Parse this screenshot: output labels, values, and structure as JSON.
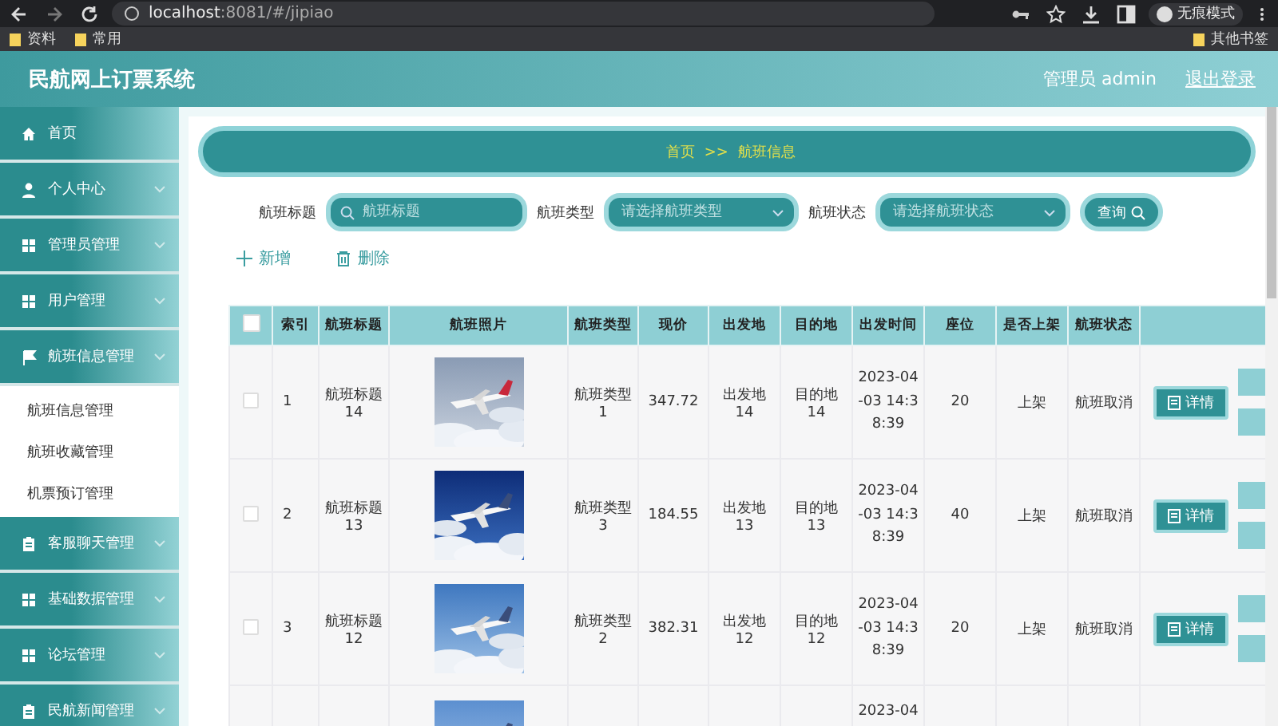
{
  "browser": {
    "url_host": "localhost",
    "url_rest": ":8081/#/jipiao",
    "profile": "无痕模式",
    "bookmarks": [
      "资料",
      "常用"
    ],
    "other_bookmarks": "其他书签"
  },
  "header": {
    "title": "民航网上订票系统",
    "user": "管理员 admin",
    "logout": "退出登录"
  },
  "sidebar": {
    "items": [
      {
        "label": "首页",
        "kind": "home"
      },
      {
        "label": "个人中心",
        "kind": "user"
      },
      {
        "label": "管理员管理",
        "kind": "grid"
      },
      {
        "label": "用户管理",
        "kind": "grid"
      },
      {
        "label": "航班信息管理",
        "kind": "flag",
        "children": [
          {
            "label": "航班信息管理"
          },
          {
            "label": "航班收藏管理"
          },
          {
            "label": "机票预订管理"
          }
        ]
      },
      {
        "label": "客服聊天管理",
        "kind": "clipboard"
      },
      {
        "label": "基础数据管理",
        "kind": "grid"
      },
      {
        "label": "论坛管理",
        "kind": "grid"
      },
      {
        "label": "民航新闻管理",
        "kind": "clipboard"
      }
    ]
  },
  "breadcrumb": "首页 >> 航班信息",
  "search": {
    "fields": [
      {
        "label": "航班标题",
        "kind": "input",
        "placeholder": "航班标题"
      },
      {
        "label": "航班类型",
        "kind": "select",
        "placeholder": "请选择航班类型"
      },
      {
        "label": "航班状态",
        "kind": "select",
        "placeholder": "请选择航班状态"
      }
    ],
    "button": "查询"
  },
  "actions": [
    {
      "kind": "add",
      "label": "新增"
    },
    {
      "kind": "delete",
      "label": "删除"
    }
  ],
  "table": {
    "all_selected": false,
    "columns": [
      "索引",
      "航班标题",
      "航班照片",
      "航班类型",
      "现价",
      "出发地",
      "目的地",
      "出发时间",
      "座位",
      "是否上架",
      "航班状态"
    ],
    "rows": [
      {
        "selected": false,
        "cells": [
          "1",
          "航班标题14",
          {
            "kind": "picture"
          },
          "航班类型1",
          "347.72",
          "出发地14",
          "目的地14",
          "2023-04-03 14:38:39",
          "20",
          "上架",
          "航班取消"
        ],
        "button": "详情"
      },
      {
        "selected": false,
        "cells": [
          "2",
          "航班标题13",
          {
            "kind": "picture"
          },
          "航班类型3",
          "184.55",
          "出发地13",
          "目的地13",
          "2023-04-03 14:38:39",
          "40",
          "上架",
          "航班取消"
        ],
        "button": "详情"
      },
      {
        "selected": false,
        "cells": [
          "3",
          "航班标题12",
          {
            "kind": "picture"
          },
          "航班类型2",
          "382.31",
          "出发地12",
          "目的地12",
          "2023-04-03 14:38:39",
          "20",
          "上架",
          "航班取消"
        ],
        "button": "详情"
      },
      {
        "cells": [
          null,
          null,
          {
            "kind": "picture"
          },
          null,
          null,
          null,
          null,
          "2023-04",
          null,
          null,
          null
        ]
      }
    ]
  }
}
